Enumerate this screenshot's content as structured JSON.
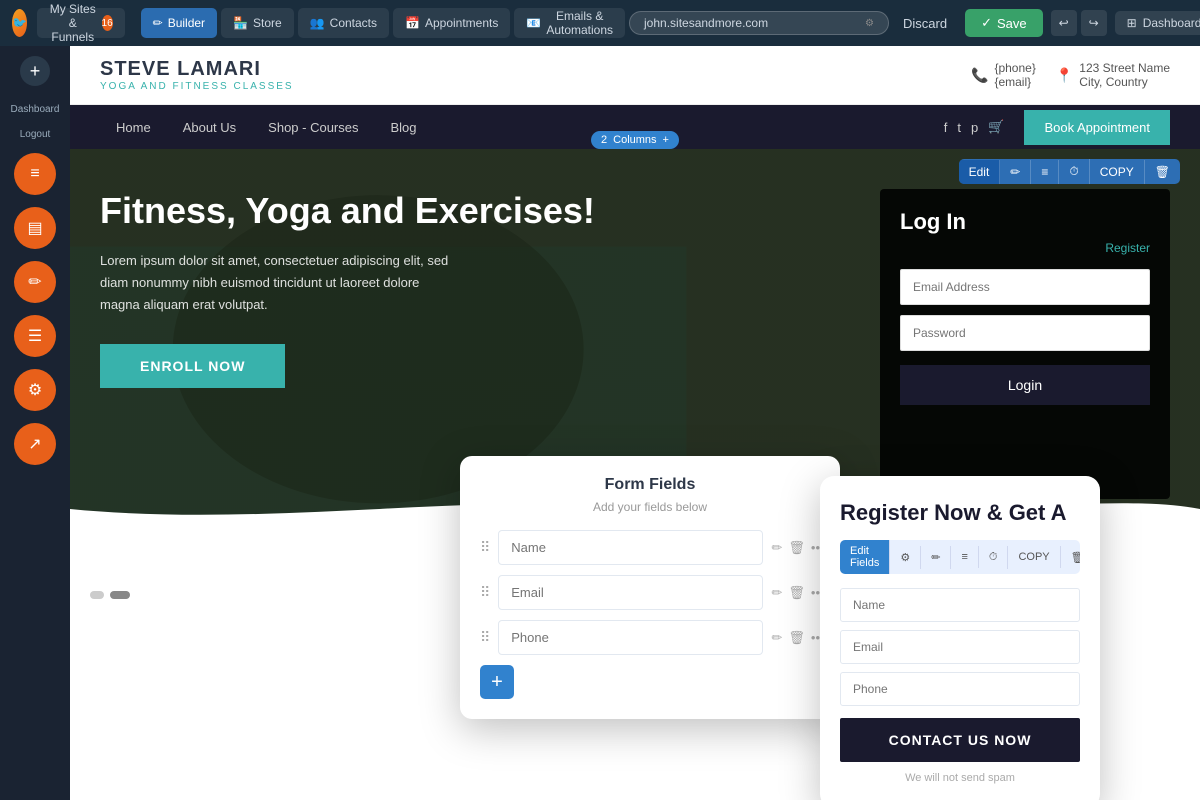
{
  "topnav": {
    "logo_text": "🐦",
    "sites_funnels_label": "My Sites & Funnels",
    "sites_count": "16",
    "builder_label": "Builder",
    "store_label": "Store",
    "contacts_label": "Contacts",
    "appointments_label": "Appointments",
    "emails_label": "Emails & Automations",
    "url": "john.sitesandmore.com",
    "discard_label": "Discard",
    "save_label": "Save",
    "dashboard_label": "Dashboard"
  },
  "sidebar": {
    "dashboard_label": "Dashboard",
    "logout_label": "Logout",
    "icons": [
      "≡",
      "▤",
      "✏",
      "☰",
      "⚙",
      "↗"
    ]
  },
  "site_header": {
    "site_name": "STEVE LAMARI",
    "site_tagline": "YOGA AND FITNESS CLASSES",
    "phone": "{phone}",
    "email": "{email}",
    "address_line1": "123 Street Name",
    "address_line2": "City, Country"
  },
  "site_nav": {
    "links": [
      "Home",
      "About Us",
      "Shop - Courses",
      "Blog"
    ],
    "cta_label": "Book Appointment"
  },
  "hero": {
    "columns_label": "2  Columns",
    "title": "Fitness, Yoga and Exercises!",
    "description": "Lorem ipsum dolor sit amet, consectetuer adipiscing elit, sed diam nonummy nibh euismod tincidunt ut laoreet dolore magna aliquam erat volutpat.",
    "enroll_btn": "ENROLL NOW",
    "edit_toolbar": [
      "Edit",
      "✏",
      "≡",
      "⏱",
      "COPY",
      "🗑"
    ],
    "login_title": "Log In",
    "register_link": "Register",
    "email_placeholder": "Email Address",
    "password_placeholder": "Password",
    "login_btn": "Login"
  },
  "form_fields_modal": {
    "title": "Form Fields",
    "subtitle": "Add your fields below",
    "fields": [
      {
        "placeholder": "Name"
      },
      {
        "placeholder": "Email"
      },
      {
        "placeholder": "Phone"
      }
    ],
    "add_btn": "+"
  },
  "register_modal": {
    "title": "Register Now & Get A",
    "toolbar_btns": [
      "Edit Fields",
      "⚙",
      "✏",
      "≡",
      "⏱",
      "COPY",
      "🗑"
    ],
    "fields": [
      {
        "placeholder": "Name"
      },
      {
        "placeholder": "Email"
      },
      {
        "placeholder": "Phone"
      }
    ],
    "cta_btn": "CONTACT US NOW",
    "no_spam": "We will not send spam"
  }
}
